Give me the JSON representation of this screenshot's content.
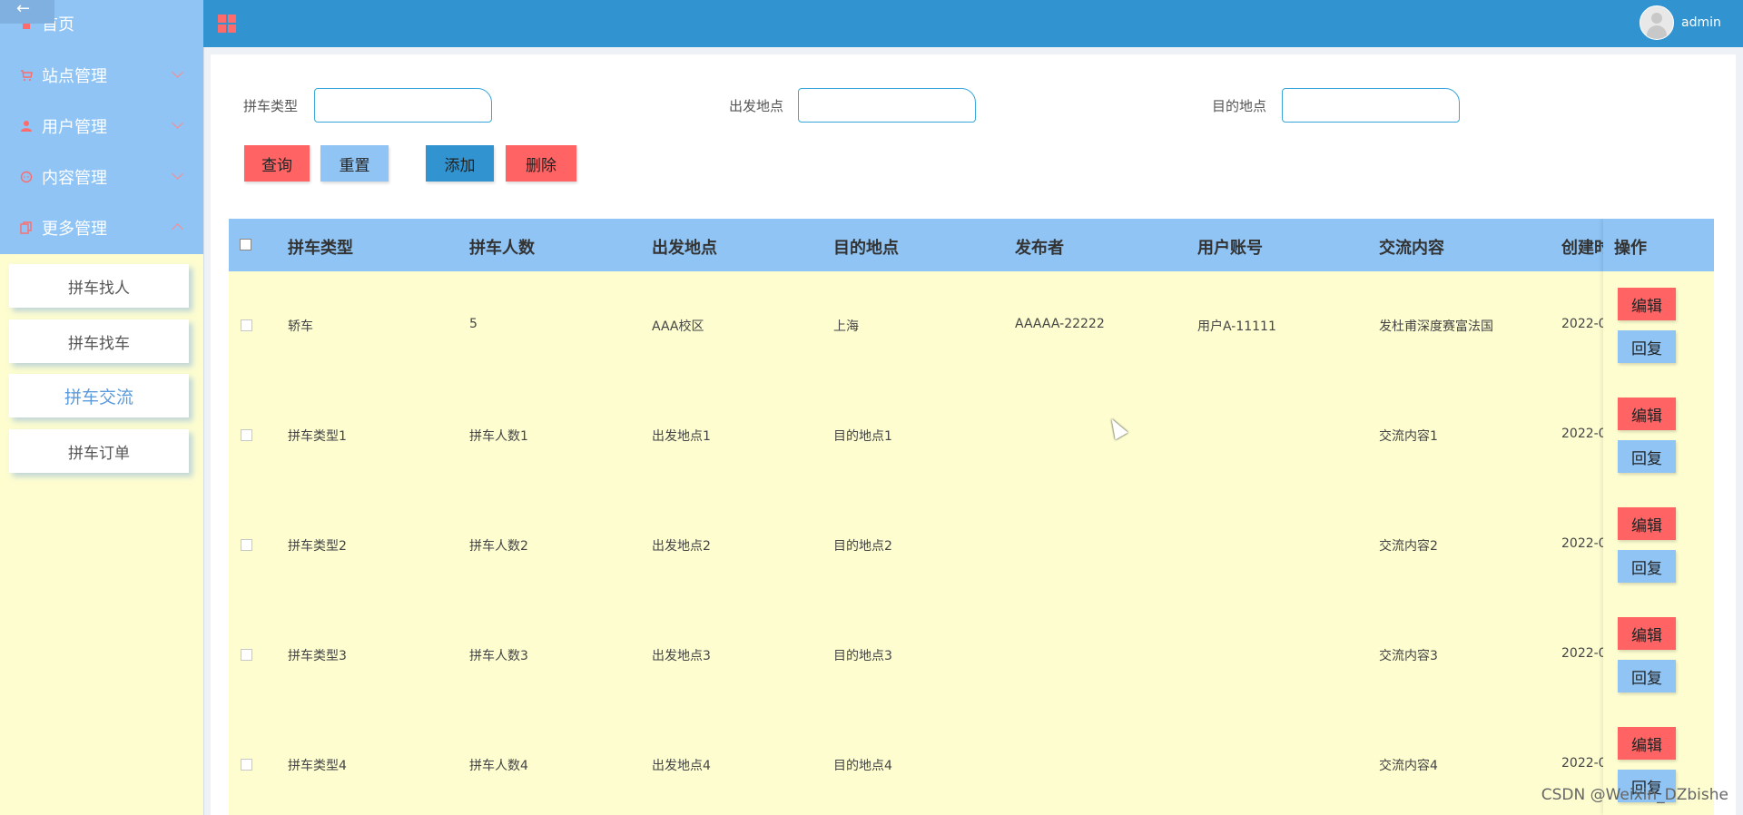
{
  "sidebar": {
    "back_arrow": "←",
    "menu": [
      {
        "label": "首页",
        "icon": "home-icon"
      },
      {
        "label": "站点管理",
        "icon": "cart-icon"
      },
      {
        "label": "用户管理",
        "icon": "user-icon"
      },
      {
        "label": "内容管理",
        "icon": "chat-icon"
      },
      {
        "label": "更多管理",
        "icon": "copy-icon"
      }
    ],
    "subitems": [
      {
        "label": "拼车找人"
      },
      {
        "label": "拼车找车"
      },
      {
        "label": "拼车交流",
        "active": true
      },
      {
        "label": "拼车订单"
      }
    ]
  },
  "header": {
    "username": "admin"
  },
  "search": {
    "fields": [
      {
        "label": "拼车类型",
        "value": ""
      },
      {
        "label": "出发地点",
        "value": ""
      },
      {
        "label": "目的地点",
        "value": ""
      }
    ],
    "buttons": {
      "query": "查询",
      "reset": "重置",
      "add": "添加",
      "delete": "删除"
    }
  },
  "table": {
    "columns": [
      "拼车类型",
      "拼车人数",
      "出发地点",
      "目的地点",
      "发布者",
      "用户账号",
      "交流内容",
      "创建时",
      "操作"
    ],
    "rows": [
      [
        "轿车",
        "5",
        "AAA校区",
        "上海",
        "AAAAA-22222",
        "用户A-11111",
        "发杜甫深度赛富法国",
        "2022-0"
      ],
      [
        "拼车类型1",
        "拼车人数1",
        "出发地点1",
        "目的地点1",
        "",
        "",
        "交流内容1",
        "2022-0"
      ],
      [
        "拼车类型2",
        "拼车人数2",
        "出发地点2",
        "目的地点2",
        "",
        "",
        "交流内容2",
        "2022-0"
      ],
      [
        "拼车类型3",
        "拼车人数3",
        "出发地点3",
        "目的地点3",
        "",
        "",
        "交流内容3",
        "2022-0"
      ],
      [
        "拼车类型4",
        "拼车人数4",
        "出发地点4",
        "目的地点4",
        "",
        "",
        "交流内容4",
        "2022-0"
      ]
    ],
    "op_buttons": {
      "edit": "编辑",
      "reply": "回复"
    }
  },
  "watermark": "CSDN @Weixin_DZbishe",
  "colors": {
    "header": "#3193cf",
    "menu": "#8fc4f4",
    "content_bg": "#fdfdd0",
    "danger": "#ff6363"
  }
}
